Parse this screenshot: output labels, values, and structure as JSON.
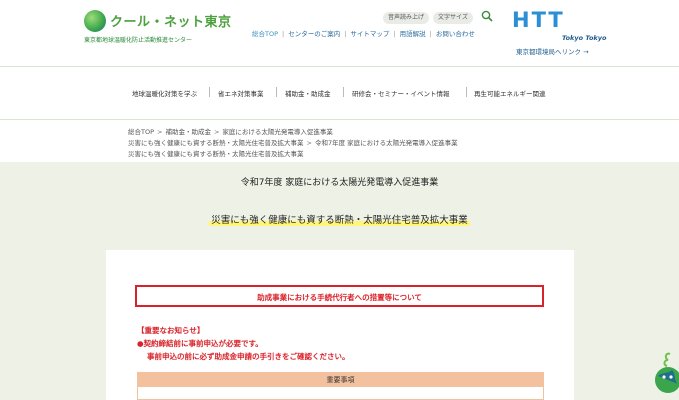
{
  "header": {
    "logo_title": "クール・ネット東京",
    "logo_sub": "東京都地球温暖化防止活動推進センター",
    "util_audio": "音声読み上げ",
    "util_font": "文字サイズ",
    "topnav": [
      "総合TOP",
      "センターのご案内",
      "サイトマップ",
      "用語解説",
      "お問い合わせ"
    ],
    "htt_letters": "HTT",
    "htt_tokyo": "Tokyo Tokyo",
    "htt_link": "東京都環境局へリンク →"
  },
  "gnav": [
    "地球温暖化対策を学ぶ",
    "省エネ対策事業",
    "補助金・助成金",
    "研修会・セミナー・イベント情報",
    "再生可能エネルギー関連"
  ],
  "breadcrumb": {
    "line1": [
      "総合TOP",
      "補助金・助成金",
      "家庭における太陽光発電導入促進事業"
    ],
    "line2": [
      "災害にも強く健康にも資する断熱・太陽光住宅普及拡大事業",
      "令和7年度 家庭における太陽光発電導入促進事業"
    ],
    "line3": [
      "災害にも強く健康にも資する断熱・太陽光住宅普及拡大事業"
    ]
  },
  "main": {
    "title_1": "令和7年度 家庭における太陽光発電導入促進事業",
    "title_2": "災害にも強く健康にも資する断熱・太陽光住宅普及拡大事業",
    "notice": "助成事業における手続代行者への措置等について",
    "important_head": "【重要なお知らせ】",
    "important_line1": "●契約締結前に事前申込が必要です。",
    "important_line2": "事前申込の前に必ず助成金申請の手引きをご確認ください。",
    "juyo_label": "重要事項"
  },
  "colors": {
    "brand_green": "#4aa03c",
    "htt_blue": "#2a8fd4",
    "alert_red": "#d9232a",
    "band_bg": "#eef1e6",
    "juyo_orange": "#f4c19f"
  }
}
